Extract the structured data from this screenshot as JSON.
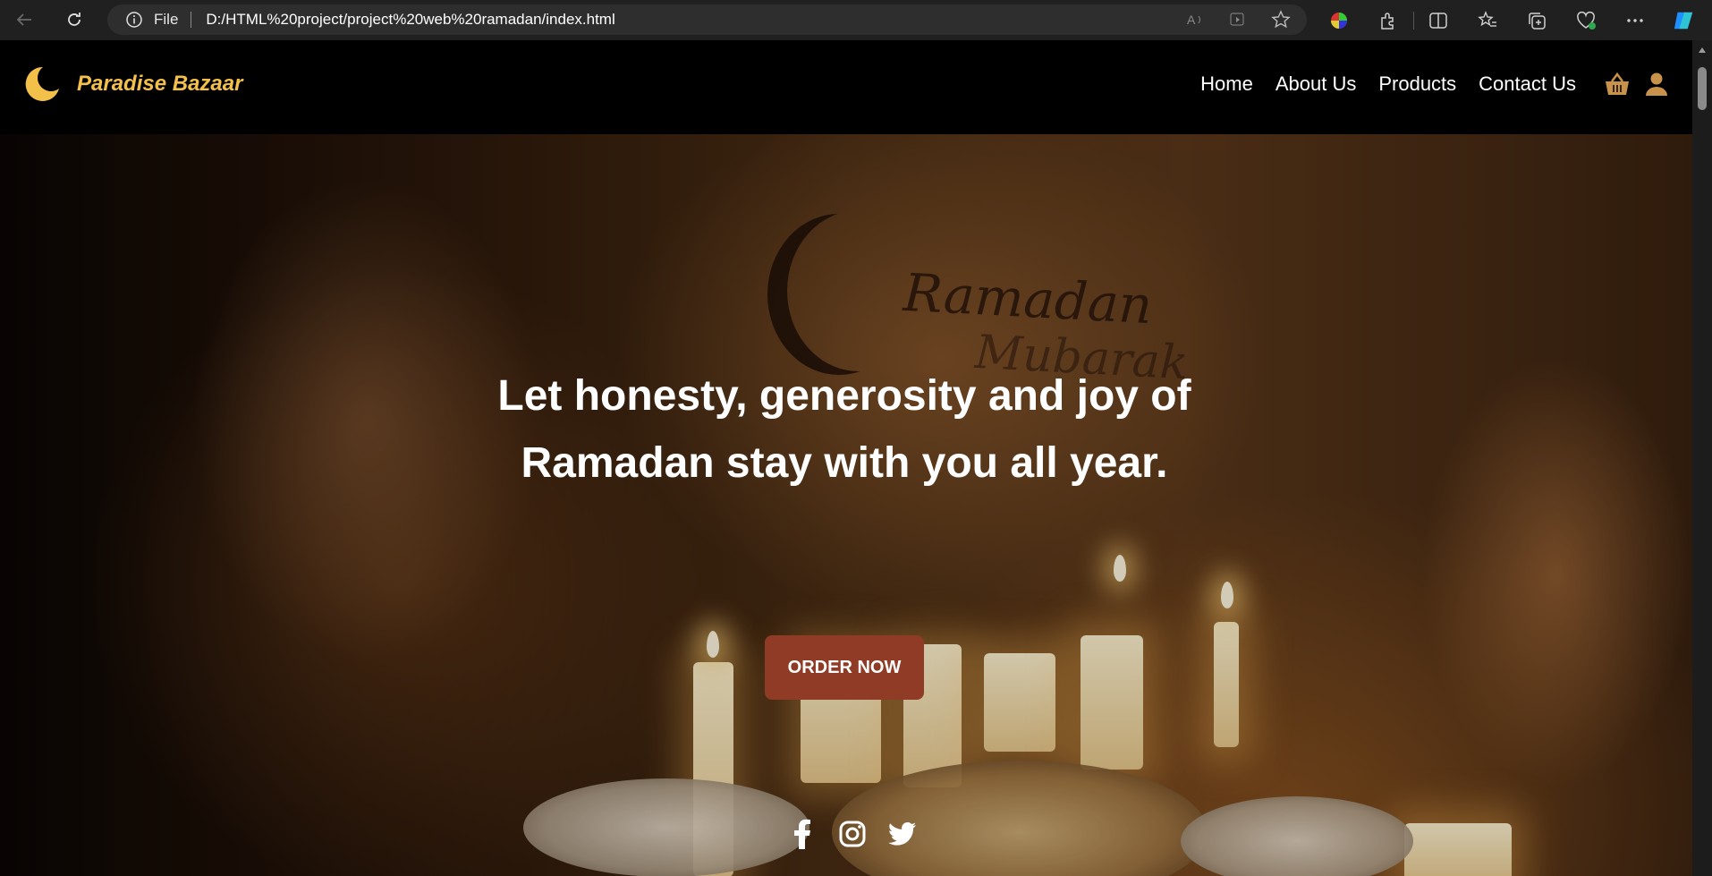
{
  "browser": {
    "file_label": "File",
    "url": "D:/HTML%20project/project%20web%20ramadan/index.html",
    "icons": [
      "back-icon",
      "reload-icon",
      "info-icon",
      "read-aloud-icon",
      "immersive-reader-icon",
      "favorite-star-icon",
      "color-wheel-icon",
      "extensions-icon",
      "split-screen-icon",
      "favorites-icon",
      "collections-icon",
      "health-icon",
      "more-icon",
      "copilot-icon"
    ]
  },
  "site": {
    "brand": "Paradise Bazaar",
    "brand_color": "#f3c14a",
    "nav": [
      "Home",
      "About Us",
      "Products",
      "Contact Us"
    ],
    "header_icons": [
      "basket-icon",
      "user-icon"
    ]
  },
  "hero": {
    "title": "Let honesty, generosity and joy of Ramadan stay with you all year.",
    "cta_label": "ORDER NOW",
    "cta_color": "#8f3b25",
    "wall_text_line1": "Ramadan",
    "wall_text_line2": "Mubarak",
    "socials": [
      "facebook-icon",
      "instagram-icon",
      "twitter-icon"
    ]
  }
}
